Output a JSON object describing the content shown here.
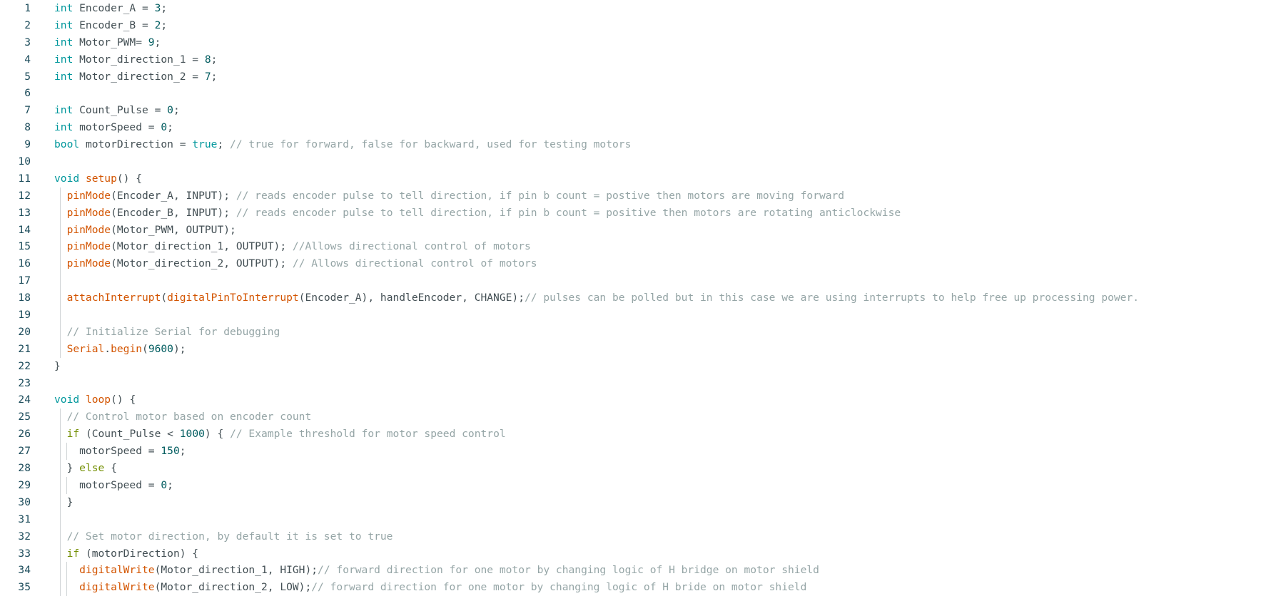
{
  "colors": {
    "background": "#ffffff",
    "line_number": "#1b4b5a",
    "type": "#00979c",
    "keyword": "#728e00",
    "function": "#d35400",
    "number": "#005c5f",
    "comment": "#95a5a6",
    "default": "#434f54"
  },
  "lines": [
    {
      "num": "1",
      "tokens": [
        [
          "type",
          "int"
        ],
        [
          "def",
          " Encoder_A = "
        ],
        [
          "num",
          "3"
        ],
        [
          "def",
          ";"
        ]
      ]
    },
    {
      "num": "2",
      "tokens": [
        [
          "type",
          "int"
        ],
        [
          "def",
          " Encoder_B = "
        ],
        [
          "num",
          "2"
        ],
        [
          "def",
          ";"
        ]
      ]
    },
    {
      "num": "3",
      "tokens": [
        [
          "type",
          "int"
        ],
        [
          "def",
          " Motor_PWM= "
        ],
        [
          "num",
          "9"
        ],
        [
          "def",
          ";"
        ]
      ]
    },
    {
      "num": "4",
      "tokens": [
        [
          "type",
          "int"
        ],
        [
          "def",
          " Motor_direction_1 = "
        ],
        [
          "num",
          "8"
        ],
        [
          "def",
          ";"
        ]
      ]
    },
    {
      "num": "5",
      "tokens": [
        [
          "type",
          "int"
        ],
        [
          "def",
          " Motor_direction_2 = "
        ],
        [
          "num",
          "7"
        ],
        [
          "def",
          ";"
        ]
      ]
    },
    {
      "num": "6",
      "tokens": []
    },
    {
      "num": "7",
      "tokens": [
        [
          "type",
          "int"
        ],
        [
          "def",
          " Count_Pulse = "
        ],
        [
          "num",
          "0"
        ],
        [
          "def",
          ";"
        ]
      ]
    },
    {
      "num": "8",
      "tokens": [
        [
          "type",
          "int"
        ],
        [
          "def",
          " motorSpeed = "
        ],
        [
          "num",
          "0"
        ],
        [
          "def",
          ";"
        ]
      ]
    },
    {
      "num": "9",
      "tokens": [
        [
          "type",
          "bool"
        ],
        [
          "def",
          " motorDirection = "
        ],
        [
          "type",
          "true"
        ],
        [
          "def",
          "; "
        ],
        [
          "com",
          "// true for forward, false for backward, used for testing motors"
        ]
      ]
    },
    {
      "num": "10",
      "tokens": []
    },
    {
      "num": "11",
      "tokens": [
        [
          "type",
          "void"
        ],
        [
          "def",
          " "
        ],
        [
          "fn",
          "setup"
        ],
        [
          "def",
          "() {"
        ]
      ]
    },
    {
      "num": "12",
      "guides": [
        1
      ],
      "tokens": [
        [
          "def",
          "  "
        ],
        [
          "fn",
          "pinMode"
        ],
        [
          "def",
          "(Encoder_A, INPUT); "
        ],
        [
          "com",
          "// reads encoder pulse to tell direction, if pin b count = postive then motors are moving forward"
        ]
      ]
    },
    {
      "num": "13",
      "guides": [
        1
      ],
      "tokens": [
        [
          "def",
          "  "
        ],
        [
          "fn",
          "pinMode"
        ],
        [
          "def",
          "(Encoder_B, INPUT); "
        ],
        [
          "com",
          "// reads encoder pulse to tell direction, if pin b count = positive then motors are rotating anticlockwise"
        ]
      ]
    },
    {
      "num": "14",
      "guides": [
        1
      ],
      "tokens": [
        [
          "def",
          "  "
        ],
        [
          "fn",
          "pinMode"
        ],
        [
          "def",
          "(Motor_PWM, OUTPUT);"
        ]
      ]
    },
    {
      "num": "15",
      "guides": [
        1
      ],
      "tokens": [
        [
          "def",
          "  "
        ],
        [
          "fn",
          "pinMode"
        ],
        [
          "def",
          "(Motor_direction_1, OUTPUT); "
        ],
        [
          "com",
          "//Allows directional control of motors"
        ]
      ]
    },
    {
      "num": "16",
      "guides": [
        1
      ],
      "tokens": [
        [
          "def",
          "  "
        ],
        [
          "fn",
          "pinMode"
        ],
        [
          "def",
          "(Motor_direction_2, OUTPUT); "
        ],
        [
          "com",
          "// Allows directional control of motors"
        ]
      ]
    },
    {
      "num": "17",
      "guides": [
        1
      ],
      "tokens": []
    },
    {
      "num": "18",
      "guides": [
        1
      ],
      "tokens": [
        [
          "def",
          "  "
        ],
        [
          "fn",
          "attachInterrupt"
        ],
        [
          "def",
          "("
        ],
        [
          "fn",
          "digitalPinToInterrupt"
        ],
        [
          "def",
          "(Encoder_A), handleEncoder, CHANGE);"
        ],
        [
          "com",
          "// pulses can be polled but in this case we are using interrupts to help free up processing power."
        ]
      ]
    },
    {
      "num": "19",
      "guides": [
        1
      ],
      "tokens": []
    },
    {
      "num": "20",
      "guides": [
        1
      ],
      "tokens": [
        [
          "def",
          "  "
        ],
        [
          "com",
          "// Initialize Serial for debugging"
        ]
      ]
    },
    {
      "num": "21",
      "guides": [
        1
      ],
      "tokens": [
        [
          "def",
          "  "
        ],
        [
          "fn",
          "Serial"
        ],
        [
          "def",
          "."
        ],
        [
          "fn",
          "begin"
        ],
        [
          "def",
          "("
        ],
        [
          "num",
          "9600"
        ],
        [
          "def",
          ");"
        ]
      ]
    },
    {
      "num": "22",
      "tokens": [
        [
          "def",
          "}"
        ]
      ]
    },
    {
      "num": "23",
      "tokens": []
    },
    {
      "num": "24",
      "tokens": [
        [
          "type",
          "void"
        ],
        [
          "def",
          " "
        ],
        [
          "fn",
          "loop"
        ],
        [
          "def",
          "() {"
        ]
      ]
    },
    {
      "num": "25",
      "guides": [
        1
      ],
      "tokens": [
        [
          "def",
          "  "
        ],
        [
          "com",
          "// Control motor based on encoder count"
        ]
      ]
    },
    {
      "num": "26",
      "guides": [
        1
      ],
      "tokens": [
        [
          "def",
          "  "
        ],
        [
          "kw",
          "if"
        ],
        [
          "def",
          " (Count_Pulse < "
        ],
        [
          "num",
          "1000"
        ],
        [
          "def",
          ") { "
        ],
        [
          "com",
          "// Example threshold for motor speed control"
        ]
      ]
    },
    {
      "num": "27",
      "guides": [
        1,
        2
      ],
      "tokens": [
        [
          "def",
          "    motorSpeed = "
        ],
        [
          "num",
          "150"
        ],
        [
          "def",
          ";"
        ]
      ]
    },
    {
      "num": "28",
      "guides": [
        1
      ],
      "tokens": [
        [
          "def",
          "  } "
        ],
        [
          "kw",
          "else"
        ],
        [
          "def",
          " {"
        ]
      ]
    },
    {
      "num": "29",
      "guides": [
        1,
        2
      ],
      "tokens": [
        [
          "def",
          "    motorSpeed = "
        ],
        [
          "num",
          "0"
        ],
        [
          "def",
          ";"
        ]
      ]
    },
    {
      "num": "30",
      "guides": [
        1
      ],
      "tokens": [
        [
          "def",
          "  }"
        ]
      ]
    },
    {
      "num": "31",
      "guides": [
        1
      ],
      "tokens": []
    },
    {
      "num": "32",
      "guides": [
        1
      ],
      "tokens": [
        [
          "def",
          "  "
        ],
        [
          "com",
          "// Set motor direction, by default it is set to true"
        ]
      ]
    },
    {
      "num": "33",
      "guides": [
        1
      ],
      "tokens": [
        [
          "def",
          "  "
        ],
        [
          "kw",
          "if"
        ],
        [
          "def",
          " (motorDirection) {"
        ]
      ]
    },
    {
      "num": "34",
      "guides": [
        1,
        2
      ],
      "tokens": [
        [
          "def",
          "    "
        ],
        [
          "fn",
          "digitalWrite"
        ],
        [
          "def",
          "(Motor_direction_1, HIGH);"
        ],
        [
          "com",
          "// forward direction for one motor by changing logic of H bridge on motor shield"
        ]
      ]
    },
    {
      "num": "35",
      "guides": [
        1,
        2
      ],
      "tokens": [
        [
          "def",
          "    "
        ],
        [
          "fn",
          "digitalWrite"
        ],
        [
          "def",
          "(Motor_direction_2, LOW);"
        ],
        [
          "com",
          "// forward direction for one motor by changing logic of H bride on motor shield"
        ]
      ]
    }
  ]
}
